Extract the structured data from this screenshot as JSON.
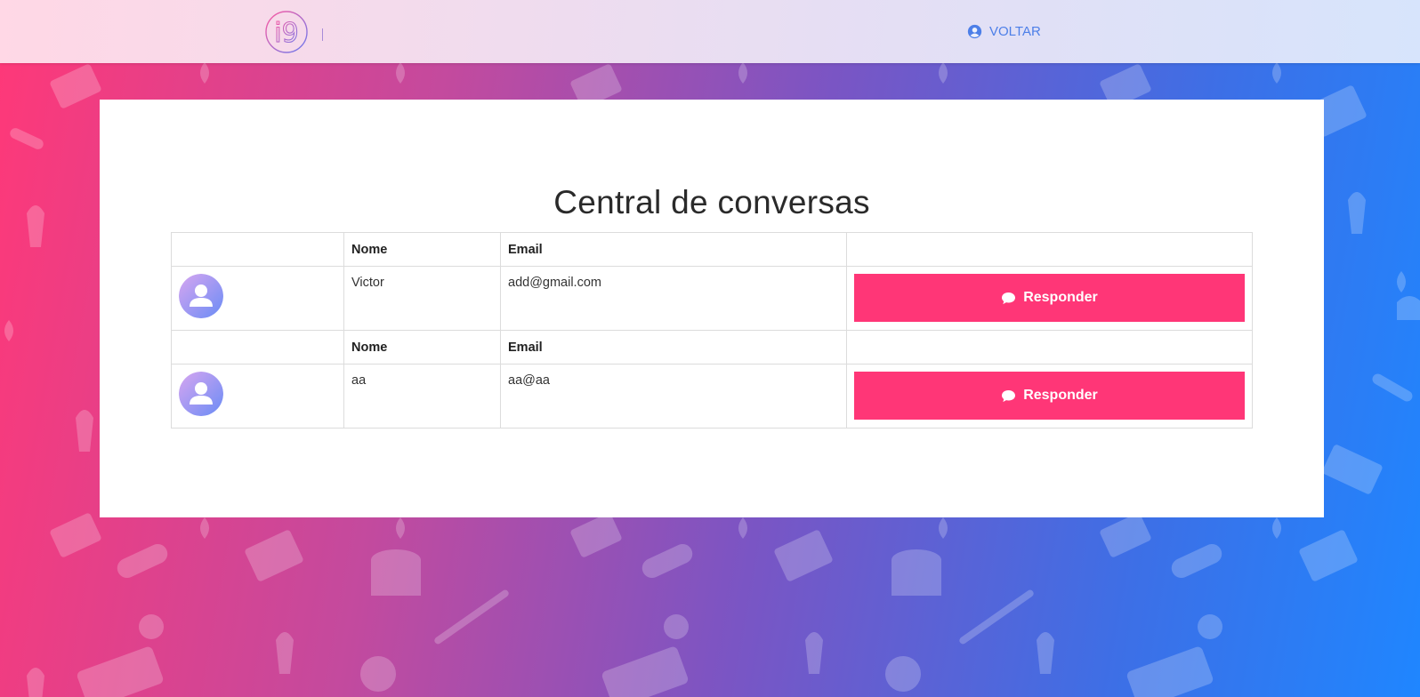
{
  "header": {
    "logo_text": "i9",
    "back_label": "VOLTAR",
    "back_icon": "user-circle-icon"
  },
  "main": {
    "title": "Central de conversas",
    "columns": {
      "name": "Nome",
      "email": "Email"
    },
    "conversations": [
      {
        "name": "Victor",
        "email": "add@gmail.com",
        "avatar_icon": "user-avatar-icon",
        "action_label": "Responder",
        "action_icon": "chat-bubble-icon"
      },
      {
        "name": "aa",
        "email": "aa@aa",
        "avatar_icon": "user-avatar-icon",
        "action_label": "Responder",
        "action_icon": "chat-bubble-icon"
      }
    ]
  },
  "colors": {
    "accent": "#ff3677",
    "link": "#4d7fe8",
    "gradient_start": "#ff3878",
    "gradient_end": "#1f86ff"
  }
}
